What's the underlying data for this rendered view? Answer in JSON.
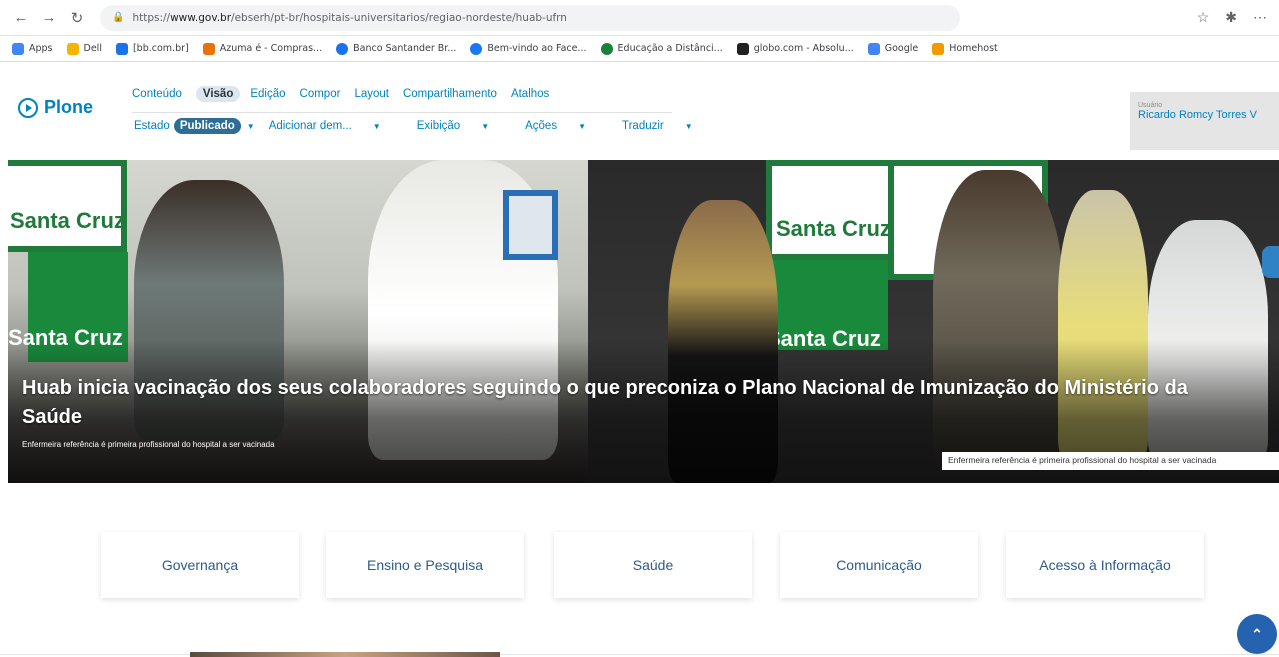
{
  "browser": {
    "url_prefix": "https://",
    "url_host": "www.gov.br",
    "url_path": "/ebserh/pt-br/hospitais-universitarios/regiao-nordeste/huab-ufrn",
    "bookmarks": [
      {
        "label": "Apps",
        "color": "#4285f4"
      },
      {
        "label": "Dell",
        "color": "#f4b400"
      },
      {
        "label": "[bb.com.br]",
        "color": "#1a73e8"
      },
      {
        "label": "Azuma é - Compras...",
        "color": "#e8710a"
      },
      {
        "label": "Banco Santander Br...",
        "color": "#1a73e8"
      },
      {
        "label": "Bem-vindo ao Face...",
        "color": "#1877f2"
      },
      {
        "label": "Educação a Distânci...",
        "color": "#188038"
      },
      {
        "label": "globo.com - Absolu...",
        "color": "#202124"
      },
      {
        "label": "Google",
        "color": "#4285f4"
      },
      {
        "label": "Homehost",
        "color": "#f29900"
      }
    ]
  },
  "plone": {
    "logo": "Plone",
    "row1": [
      "Conteúdo",
      "Visão",
      "Edição",
      "Compor",
      "Layout",
      "Compartilhamento",
      "Atalhos"
    ],
    "row1_active": "Visão",
    "state_label": "Estado",
    "state_value": "Publicado",
    "row2": [
      "Adicionar dem...",
      "Exibição",
      "Ações",
      "Traduzir"
    ],
    "user_label": "Usuário",
    "user_name": "Ricardo Romcy Torres V"
  },
  "hero": {
    "title": "Huab inicia vacinação dos seus colaboradores seguindo o que preconiza o Plano Nacional de Imunização do Ministério da Saúde",
    "subtitle": "Enfermeira referência é primeira profissional do hospital a ser vacinada",
    "caption": "Enfermeira referência é primeira profissional do hospital a ser vacinada",
    "banner_label": "Santa Cruz"
  },
  "nav_cards": [
    "Governança",
    "Ensino e Pesquisa",
    "Saúde",
    "Comunicação",
    "Acesso à Informação"
  ],
  "colors": {
    "plone_blue": "#0083be",
    "card_text": "#2c5b8a",
    "publish_badge": "#2c6e96",
    "back_to_top": "#2563b0"
  }
}
